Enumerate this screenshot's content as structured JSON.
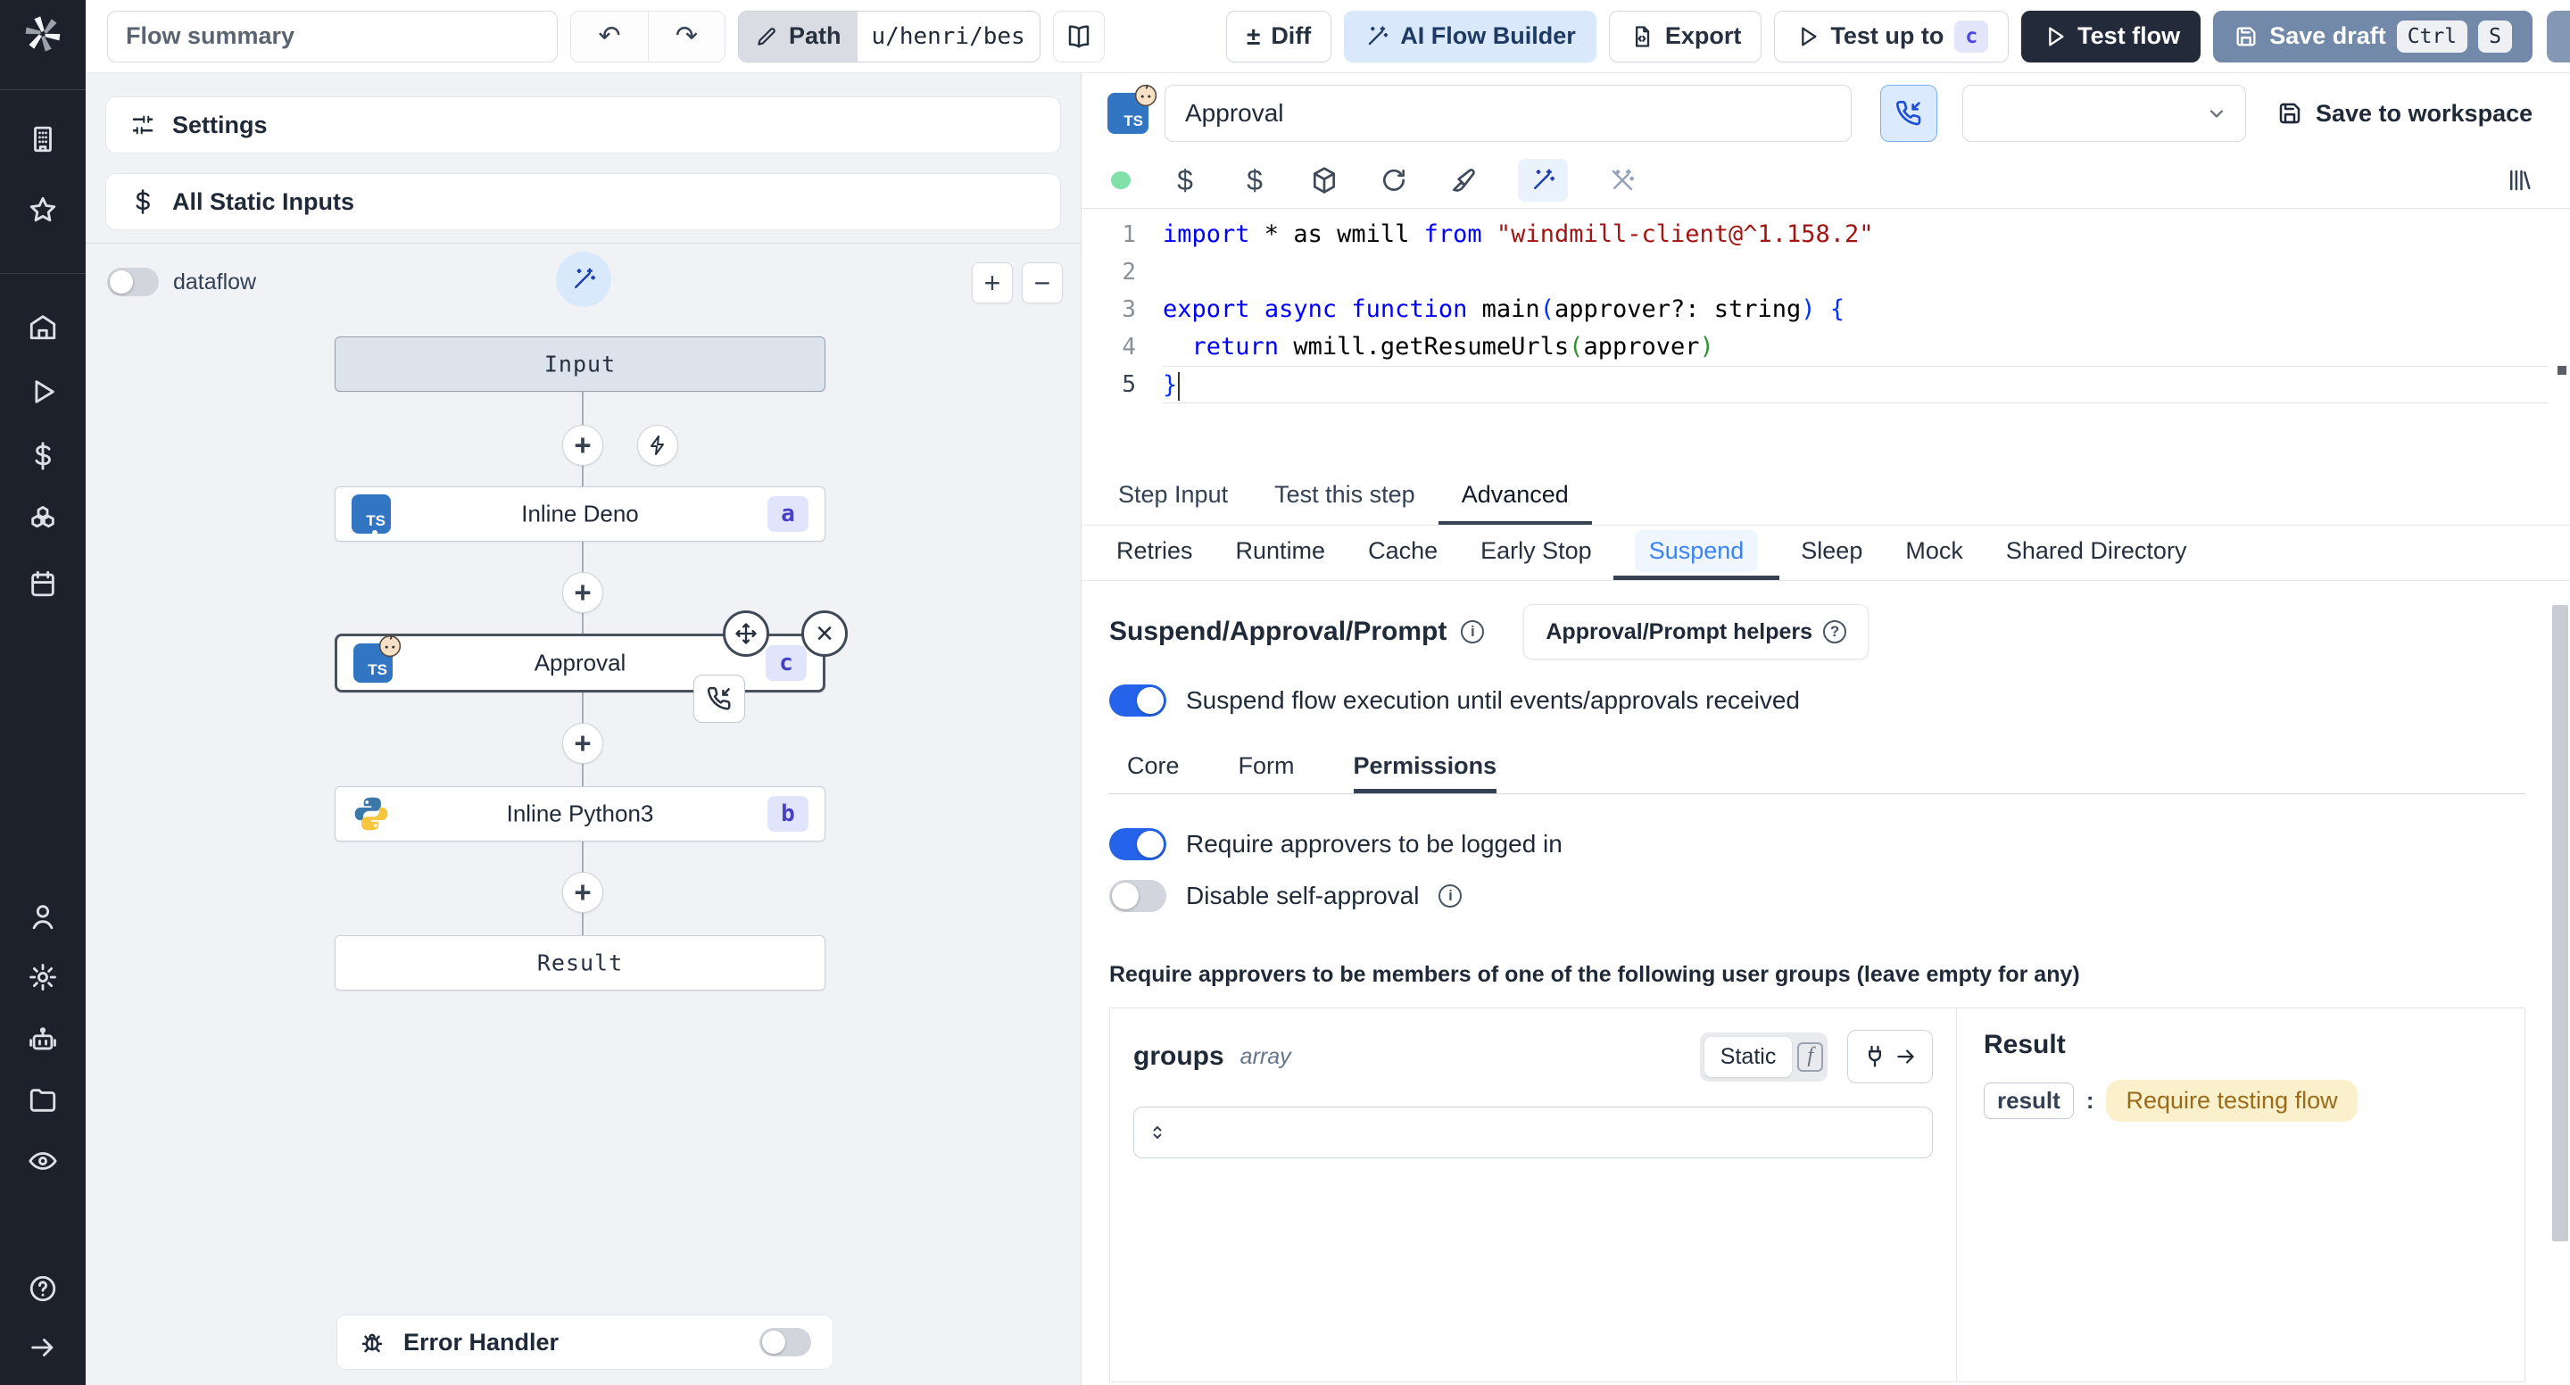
{
  "colors": {
    "sidebar_bg": "#1d212b",
    "accent_blue": "#2563eb",
    "light_blue_bg": "#dbeafe",
    "badge_indigo_text": "#4640c8",
    "badge_indigo_bg": "#e1e5fb",
    "save_draft_bg": "#7289a9",
    "test_flow_bg": "#232b3a",
    "result_value_bg": "#faf0cc",
    "result_value_text": "#9a6b1a",
    "code_keyword": "#0000ff",
    "code_string": "#a31515",
    "status_dot_green": "#80e0a7"
  },
  "icons": {
    "ts": "TS",
    "plus": "+",
    "minus": "−",
    "close": "×",
    "info": "i",
    "help": "?",
    "diff": "±",
    "undo": "↶",
    "redo": "↷",
    "sidebar": [
      "workspace-icon",
      "favorites-icon",
      "home-icon",
      "runs-icon",
      "variables-icon",
      "resources-icon",
      "schedules-icon",
      "users-icon",
      "settings-icon",
      "workers-icon",
      "folders-icon",
      "audit-logs-icon",
      "help-icon",
      "collapse-icon"
    ]
  },
  "topbar": {
    "flow_summary": "Flow summary",
    "path_label": "Path",
    "path_value": "u/henri/bes",
    "diff_label": "Diff",
    "ai_flow_builder_label": "AI Flow Builder",
    "export_label": "Export",
    "test_up_to_label": "Test up to",
    "test_up_to_kbd": "c",
    "test_flow_label": "Test flow",
    "save_draft_label": "Save draft",
    "save_draft_kbd_ctrl": "Ctrl",
    "save_draft_kbd_s": "S"
  },
  "flow_panel": {
    "settings_label": "Settings",
    "all_static_inputs_label": "All Static Inputs",
    "dataflow_label": "dataflow",
    "toggles": {
      "dataflow": false,
      "error_handler": false
    },
    "graph": {
      "input_label": "Input",
      "result_label": "Result",
      "steps": [
        {
          "label": "Inline Deno",
          "badge": "a",
          "lang": "deno"
        },
        {
          "label": "Approval",
          "badge": "c",
          "lang": "deno",
          "selected": true
        },
        {
          "label": "Inline Python3",
          "badge": "b",
          "lang": "python3"
        }
      ]
    },
    "error_handler_label": "Error Handler"
  },
  "right_panel": {
    "header": {
      "step_name": "Approval",
      "save_to_workspace_label": "Save to workspace"
    },
    "tabs": {
      "items": [
        "Step Input",
        "Test this step",
        "Advanced"
      ],
      "active": "Advanced"
    },
    "subtabs": {
      "items": [
        "Retries",
        "Runtime",
        "Cache",
        "Early Stop",
        "Suspend",
        "Sleep",
        "Mock",
        "Shared Directory"
      ],
      "active": "Suspend"
    },
    "suspend": {
      "title": "Suspend/Approval/Prompt",
      "helpers_button_label": "Approval/Prompt helpers",
      "suspend_toggle_label": "Suspend flow execution until events/approvals received",
      "toggles": {
        "suspend_flow": true,
        "require_logged_in": true,
        "disable_self_approval": false
      },
      "subtabs": {
        "items": [
          "Core",
          "Form",
          "Permissions"
        ],
        "active": "Permissions"
      },
      "require_logged_in_label": "Require approvers to be logged in",
      "disable_self_approval_label": "Disable self-approval",
      "groups_note": "Require approvers to be members of one of the following user groups (leave empty for any)"
    },
    "groups": {
      "name": "groups",
      "type_label": "array",
      "static_label": "Static",
      "fx_label": "f"
    },
    "result": {
      "title": "Result",
      "key": "result",
      "value": "Require testing flow"
    }
  },
  "code": {
    "active_line": 5,
    "lines": [
      [
        [
          "import",
          "kw"
        ],
        [
          " * as wmill ",
          "pl"
        ],
        [
          "from",
          "kw"
        ],
        [
          " ",
          "pl"
        ],
        [
          "\"windmill-client@^1.158.2\"",
          "str"
        ]
      ],
      [],
      [
        [
          "export",
          "kw"
        ],
        [
          " ",
          "pl"
        ],
        [
          "async",
          "kw"
        ],
        [
          " ",
          "pl"
        ],
        [
          "function",
          "kw"
        ],
        [
          " main",
          "pl"
        ],
        [
          "(",
          "b1"
        ],
        [
          "approver?: string",
          "pl"
        ],
        [
          ")",
          "b1"
        ],
        [
          " ",
          "pl"
        ],
        [
          "{",
          "b1"
        ]
      ],
      [
        [
          "  ",
          "pl"
        ],
        [
          "return",
          "kw"
        ],
        [
          " wmill.getResumeUrls",
          "pl"
        ],
        [
          "(",
          "b2"
        ],
        [
          "approver",
          "pl"
        ],
        [
          ")",
          "b2"
        ]
      ],
      [
        [
          "}",
          "b1"
        ]
      ]
    ]
  }
}
